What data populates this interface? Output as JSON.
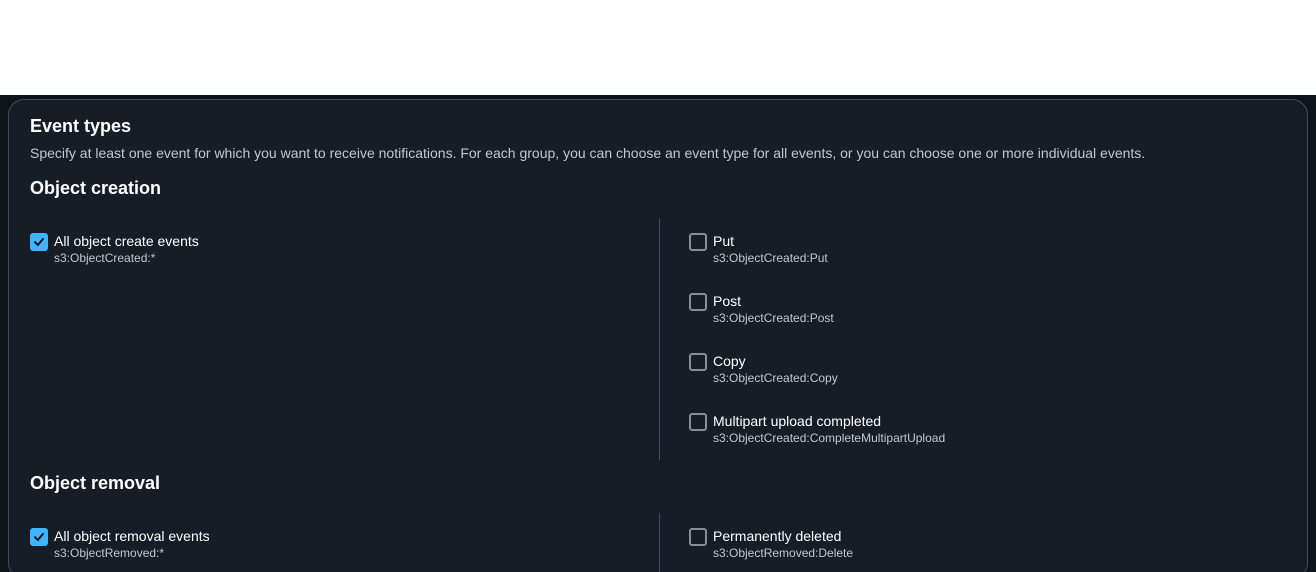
{
  "panel": {
    "title": "Event types",
    "description": "Specify at least one event for which you want to receive notifications. For each group, you can choose an event type for all events, or you can choose one or more individual events."
  },
  "groups": [
    {
      "title": "Object creation",
      "all_option": {
        "label": "All object create events",
        "code": "s3:ObjectCreated:*",
        "checked": true
      },
      "options": [
        {
          "label": "Put",
          "code": "s3:ObjectCreated:Put",
          "checked": false
        },
        {
          "label": "Post",
          "code": "s3:ObjectCreated:Post",
          "checked": false
        },
        {
          "label": "Copy",
          "code": "s3:ObjectCreated:Copy",
          "checked": false
        },
        {
          "label": "Multipart upload completed",
          "code": "s3:ObjectCreated:CompleteMultipartUpload",
          "checked": false
        }
      ]
    },
    {
      "title": "Object removal",
      "all_option": {
        "label": "All object removal events",
        "code": "s3:ObjectRemoved:*",
        "checked": true
      },
      "options": [
        {
          "label": "Permanently deleted",
          "code": "s3:ObjectRemoved:Delete",
          "checked": false
        }
      ]
    }
  ],
  "colors": {
    "accent": "#42b4ff",
    "panel_bg": "#161d26",
    "border": "#414d5c"
  }
}
